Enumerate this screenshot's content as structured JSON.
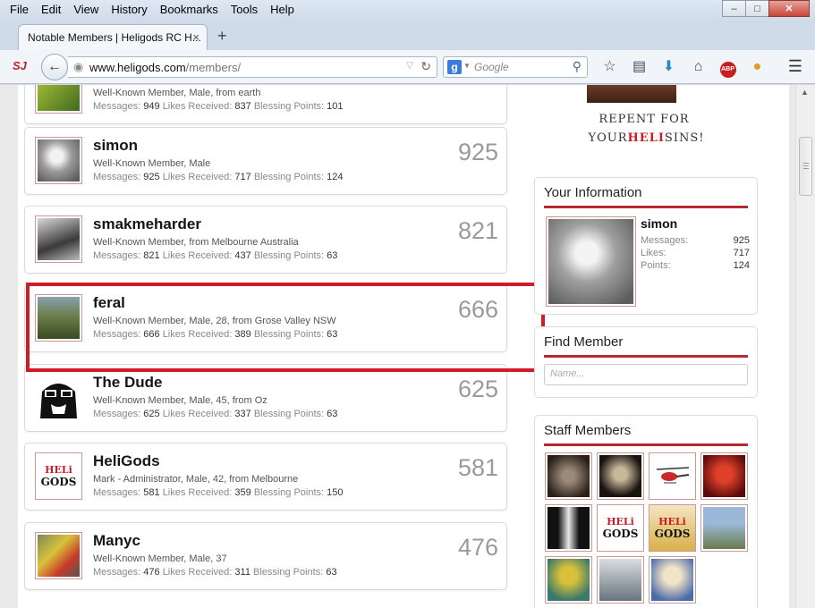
{
  "menu": [
    "File",
    "Edit",
    "View",
    "History",
    "Bookmarks",
    "Tools",
    "Help"
  ],
  "tab": {
    "title": "Notable Members | Heligods RC H...",
    "close": "×",
    "new_tab": "+"
  },
  "nav": {
    "logo": "SJ",
    "url_domain": "www.heligods.com",
    "url_path": "/members/",
    "search_engine": "g",
    "search_placeholder": "Google"
  },
  "members": [
    {
      "name": "",
      "desc": "Well-Known Member, Male, from earth",
      "messages": "949",
      "likes": "837",
      "blessing": "101",
      "count": ""
    },
    {
      "name": "simon",
      "desc": "Well-Known Member, Male",
      "messages": "925",
      "likes": "717",
      "blessing": "124",
      "count": "925"
    },
    {
      "name": "smakmeharder",
      "desc": "Well-Known Member, from Melbourne Australia",
      "messages": "821",
      "likes": "437",
      "blessing": "63",
      "count": "821"
    },
    {
      "name": "feral",
      "desc": "Well-Known Member, Male, 28, from Grose Valley NSW",
      "messages": "666",
      "likes": "389",
      "blessing": "63",
      "count": "666"
    },
    {
      "name": "The Dude",
      "desc": "Well-Known Member, Male, 45, from Oz",
      "messages": "625",
      "likes": "337",
      "blessing": "63",
      "count": "625"
    },
    {
      "name": "HeliGods",
      "desc": "Mark - Administrator, Male, 42, from Melbourne",
      "messages": "581",
      "likes": "359",
      "blessing": "150",
      "count": "581"
    },
    {
      "name": "Manyc",
      "desc": "Well-Known Member, Male, 37",
      "messages": "476",
      "likes": "311",
      "blessing": "63",
      "count": "476"
    }
  ],
  "labels": {
    "messages": "Messages:",
    "likes": "Likes Received:",
    "blessing": "Blessing Points:"
  },
  "sidebar": {
    "logo_line1": "REPENT FOR",
    "logo_line2_pre": "YOUR",
    "logo_line2_heli": "HELI",
    "logo_line2_post": "SINS!",
    "your_info_title": "Your Information",
    "user_name": "simon",
    "messages_label": "Messages:",
    "messages_value": "925",
    "likes_label": "Likes:",
    "likes_value": "717",
    "points_label": "Points:",
    "points_value": "124",
    "find_title": "Find Member",
    "find_placeholder": "Name...",
    "staff_title": "Staff Members"
  },
  "colors": {
    "accent_red": "#d21b26",
    "rule_red": "#b52a2e"
  }
}
